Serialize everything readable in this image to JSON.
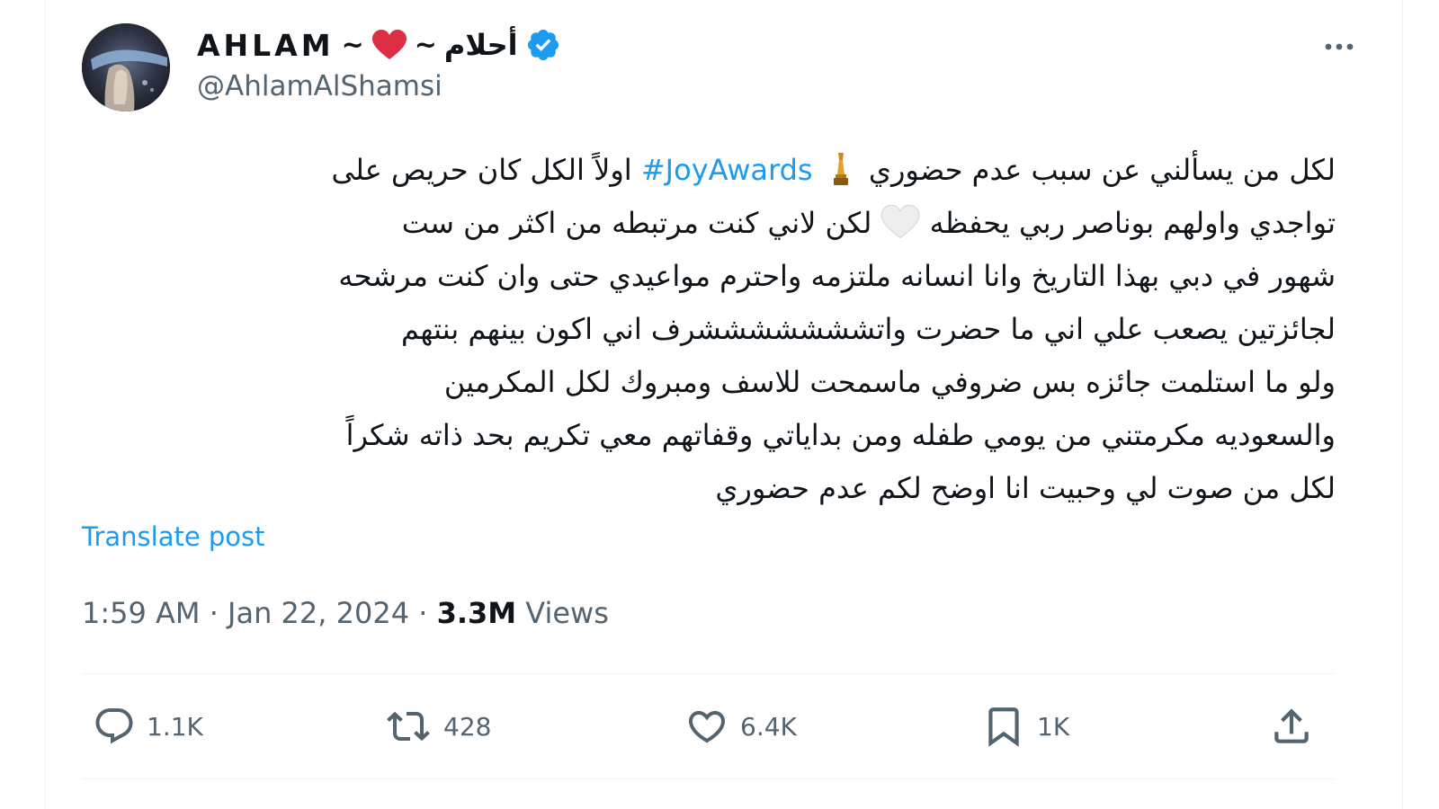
{
  "author": {
    "display_name": "AHLAM",
    "tilde_left": "~",
    "tilde_right": "~",
    "arabic_name": "أحلام",
    "handle": "@AhlamAlShamsi",
    "verified": true
  },
  "tweet": {
    "line1_a": "لكل من يسألني عن سبب عدم حضوري",
    "hashtag": "#JoyAwards",
    "line1_b": "اولاً الكل كان حريص على",
    "line2_a": "تواجدي واولهم بوناصر ربي يحفظه",
    "line2_b": "لكن  لاني كنت  مرتبطه من اكثر من ست",
    "line3": "شهور في دبي  بهذا التاريخ وانا انسانه ملتزمه واحترم مواعيدي حتى وان كنت مرشحه",
    "line4": "لجائزتين يصعب علي اني ما حضرت واتشششششششرف اني اكون بينهم بنتهم",
    "line5": "ولو ما استلمت جائزه بس ضروفي ماسمحت للاسف ومبروك لكل المكرمين",
    "line6": "والسعوديه مكرمتني من يومي طفله ومن بداياتي وقفاتهم معي تكريم بحد ذاته شكراً",
    "line7": "لكل من صوت لي وحبيت انا اوضح لكم عدم حضوري"
  },
  "translate_label": "Translate post",
  "meta": {
    "time": "1:59 AM",
    "separator": "·",
    "date": "Jan 22, 2024",
    "views_count": "3.3M",
    "views_label": "Views"
  },
  "actions": {
    "replies": "1.1K",
    "reposts": "428",
    "likes": "6.4K",
    "bookmarks": "1K"
  },
  "colors": {
    "accent": "#1d9bf0",
    "secondary_text": "#536471",
    "primary_text": "#0f1419",
    "heart_red": "#dd2e44"
  },
  "icons": [
    "more-icon",
    "verified-icon",
    "heart-emoji-icon",
    "trophy-emoji-icon",
    "white-heart-emoji-icon",
    "reply-icon",
    "repost-icon",
    "like-icon",
    "bookmark-icon",
    "share-icon"
  ]
}
